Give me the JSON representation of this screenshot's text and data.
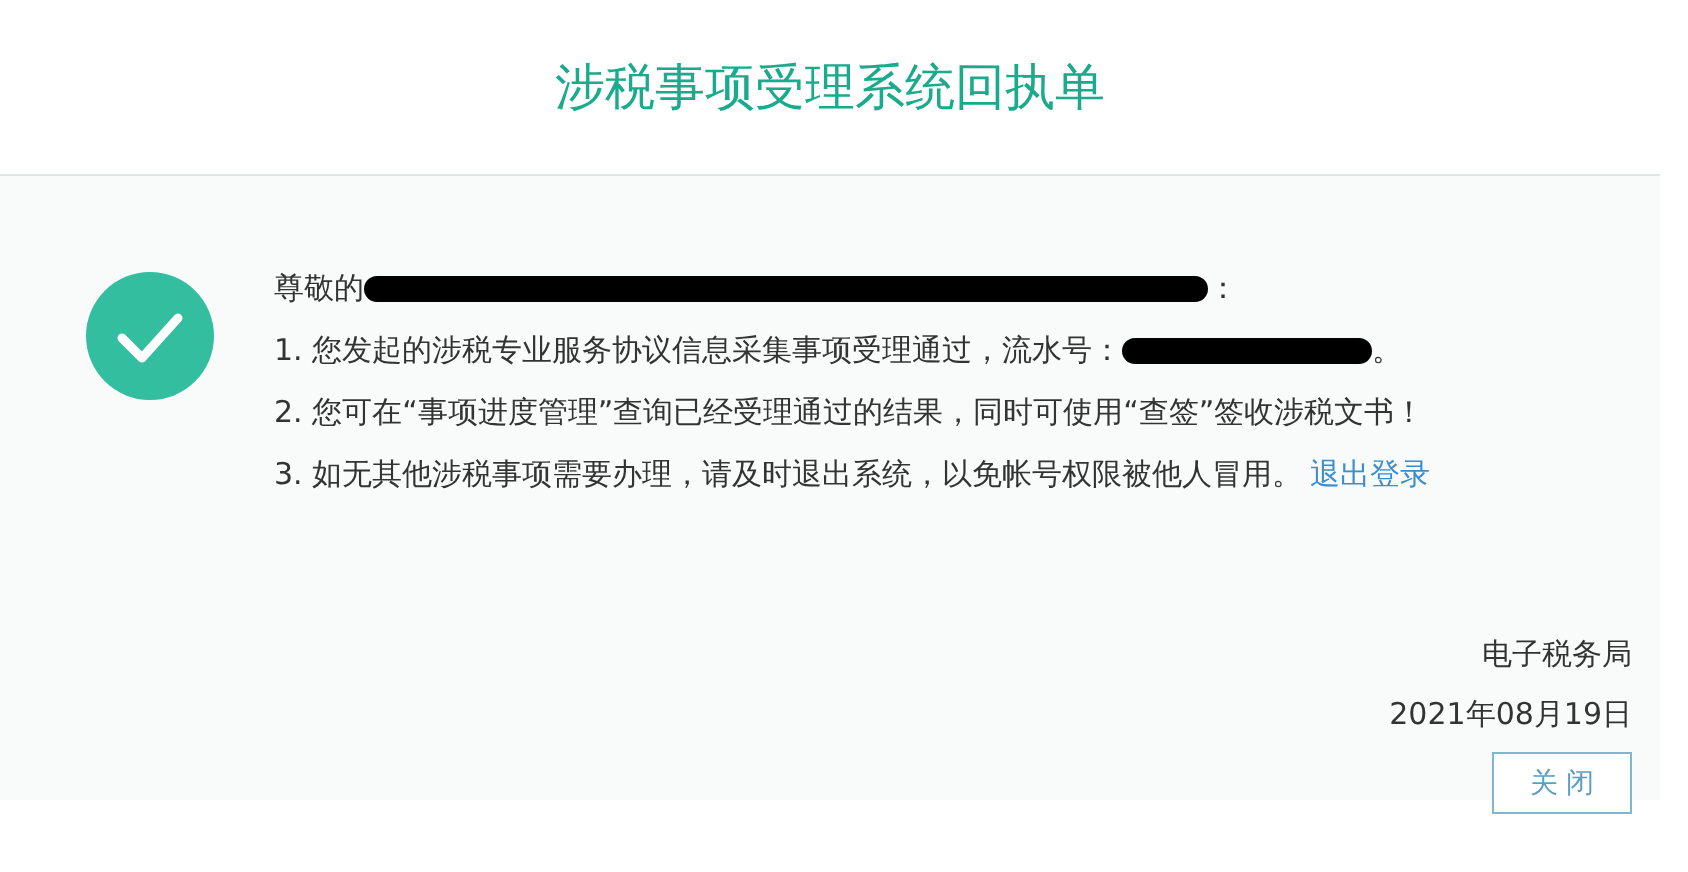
{
  "title": "涉税事项受理系统回执单",
  "lines": [
    {
      "segments": [
        {
          "kind": "text",
          "text": "尊敬的"
        },
        {
          "kind": "redaction"
        },
        {
          "kind": "text",
          "text": "："
        }
      ]
    },
    {
      "segments": [
        {
          "kind": "text",
          "text": "1. 您发起的涉税专业服务协议信息采集事项受理通过，流水号："
        },
        {
          "kind": "redaction"
        },
        {
          "kind": "text",
          "text": "。"
        }
      ]
    },
    {
      "segments": [
        {
          "kind": "text",
          "text": "2. 您可在“事项进度管理”查询已经受理通过的结果，同时可使用“查签”签收涉税文书！"
        }
      ]
    },
    {
      "segments": [
        {
          "kind": "text",
          "text": "3. 如无其他涉税事项需要办理，请及时退出系统，以免帐号权限被他人冒用。"
        },
        {
          "kind": "link",
          "text": "退出登录"
        }
      ]
    }
  ],
  "signature": "电子税务局",
  "date": "2021年08月19日",
  "close_button": "关 闭"
}
